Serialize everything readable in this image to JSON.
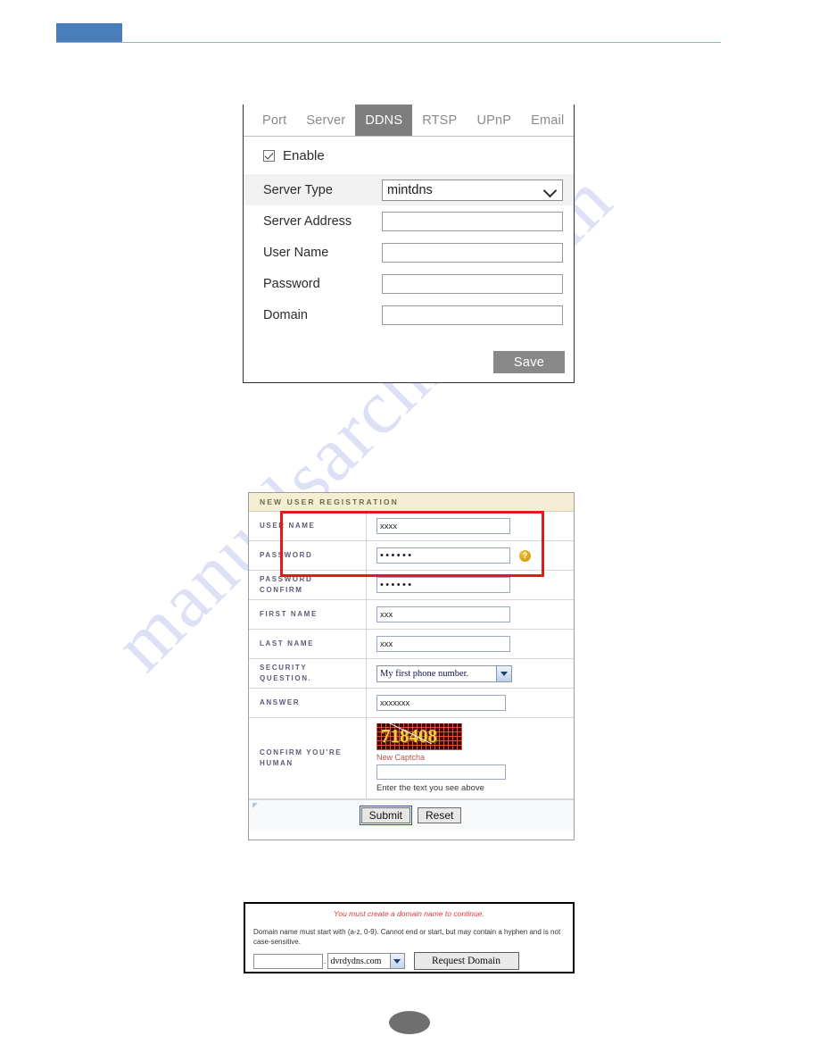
{
  "watermark": {
    "text": "manualsarchive.com"
  },
  "header": {
    "swatch_color": "#4a7ebb"
  },
  "ddns_panel": {
    "tabs": [
      {
        "label": "Port",
        "active": false
      },
      {
        "label": "Server",
        "active": false
      },
      {
        "label": "DDNS",
        "active": true
      },
      {
        "label": "RTSP",
        "active": false
      },
      {
        "label": "UPnP",
        "active": false
      },
      {
        "label": "Email",
        "active": false
      }
    ],
    "enable": {
      "label": "Enable",
      "checked": true
    },
    "fields": [
      {
        "label": "Server Type",
        "type": "select",
        "value": "mintdns"
      },
      {
        "label": "Server Address",
        "type": "text",
        "value": ""
      },
      {
        "label": "User Name",
        "type": "text",
        "value": ""
      },
      {
        "label": "Password",
        "type": "text",
        "value": ""
      },
      {
        "label": "Domain",
        "type": "text",
        "value": ""
      }
    ],
    "save_label": "Save",
    "active_tab_color": "#7e7e7e",
    "save_button_color": "#888888"
  },
  "registration": {
    "title": "NEW USER REGISTRATION",
    "rows": {
      "user_name": {
        "label": "USER NAME",
        "value": "xxxx"
      },
      "password": {
        "label": "PASSWORD",
        "value": "••••••",
        "help_icon": "question-mark-icon"
      },
      "password_confirm": {
        "label": "PASSWORD CONFIRM",
        "label_line1": "PASSWORD",
        "label_line2": "CONFIRM",
        "value": "••••••"
      },
      "first_name": {
        "label": "FIRST NAME",
        "value": "xxx"
      },
      "last_name": {
        "label": "LAST NAME",
        "value": "xxx"
      },
      "security_question": {
        "label_line1": "SECURITY",
        "label_line2": "QUESTION.",
        "value": "My first phone number."
      },
      "answer": {
        "label": "ANSWER",
        "value": "xxxxxxx"
      },
      "captcha": {
        "label_line1": "CONFIRM YOU'RE",
        "label_line2": "HUMAN",
        "image_text": "718408",
        "refresh_link": "New Captcha",
        "input_value": "",
        "hint": "Enter the text you see above"
      }
    },
    "buttons": {
      "submit": "Submit",
      "reset": "Reset"
    },
    "highlight_color": "#e01b1b",
    "title_bg": "#f4efd4"
  },
  "domain_request": {
    "warning": "You must create a domain name to continue.",
    "rule_text": "Domain name must start with (a-z, 0-9). Cannot end or start, but may contain a hyphen and is not case-sensitive.",
    "input_value": "",
    "dot": ".",
    "suffix": "dvrdydns.com",
    "button_label": "Request Domain",
    "warning_color": "#e03a3a"
  },
  "footer": {
    "page_badge": ""
  }
}
